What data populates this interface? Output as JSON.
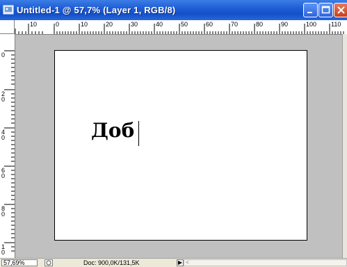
{
  "window": {
    "title": "Untitled-1 @ 57,7% (Layer 1, RGB/8)",
    "icons": {
      "app": "photoshop-doc-icon",
      "minimize": "minimize-icon",
      "maximize": "maximize-icon",
      "close": "close-icon"
    }
  },
  "ruler_top": {
    "labels": [
      "10",
      "0",
      "10",
      "20",
      "30",
      "40",
      "50",
      "60",
      "70",
      "80",
      "90",
      "100",
      "110"
    ]
  },
  "ruler_left": {
    "labels": [
      "0",
      "2 0",
      "4 0",
      "6 0",
      "8 0",
      "1 0"
    ]
  },
  "canvas": {
    "text": "Доб"
  },
  "status": {
    "zoom": "57,69%",
    "doc": "Doc: 900,0K/131,5K",
    "arrow": "▶",
    "scroll_left": "<"
  },
  "colors": {
    "titlebar": "#1f5ed6",
    "workspace": "#c0c0c0",
    "canvas": "#ffffff"
  }
}
